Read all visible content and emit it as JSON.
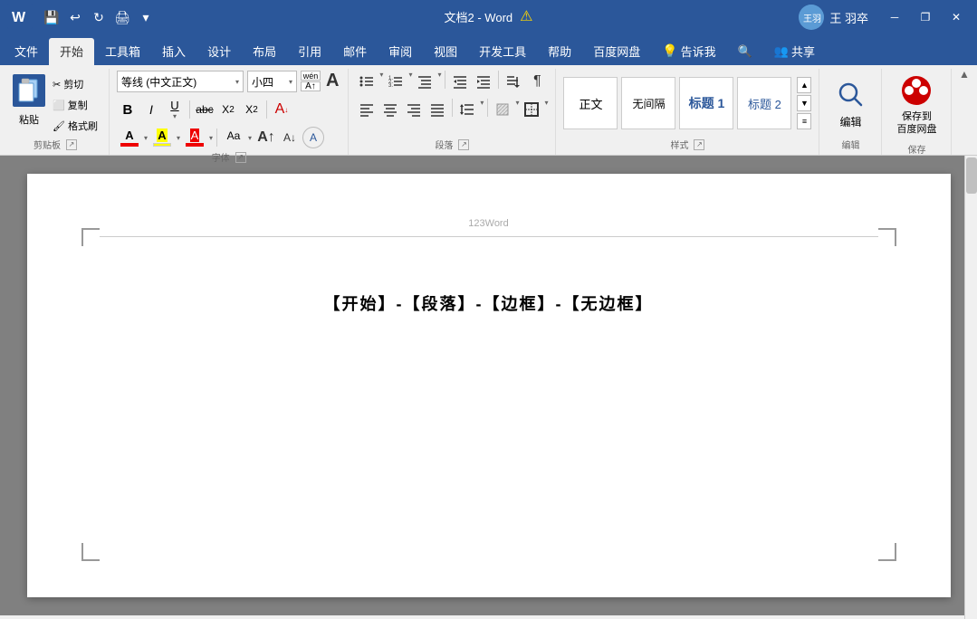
{
  "titlebar": {
    "title": "文档2 - Word",
    "warning": "⚠",
    "username": "王 羽卒",
    "quickaccess": [
      "💾",
      "↩",
      "↻",
      "🖨",
      "▼"
    ]
  },
  "windowcontrols": {
    "minimize": "─",
    "restore": "❐",
    "close": "✕"
  },
  "tabs": [
    {
      "label": "文件",
      "active": false
    },
    {
      "label": "开始",
      "active": true
    },
    {
      "label": "工具箱",
      "active": false
    },
    {
      "label": "插入",
      "active": false
    },
    {
      "label": "设计",
      "active": false
    },
    {
      "label": "布局",
      "active": false
    },
    {
      "label": "引用",
      "active": false
    },
    {
      "label": "邮件",
      "active": false
    },
    {
      "label": "审阅",
      "active": false
    },
    {
      "label": "视图",
      "active": false
    },
    {
      "label": "开发工具",
      "active": false
    },
    {
      "label": "帮助",
      "active": false
    },
    {
      "label": "百度网盘",
      "active": false
    },
    {
      "label": "❓",
      "active": false
    },
    {
      "label": "告诉我",
      "active": false
    },
    {
      "label": "🔍",
      "active": false
    },
    {
      "label": "共享",
      "active": false
    }
  ],
  "ribbon": {
    "groups": [
      {
        "name": "clipboard",
        "label": "剪贴板",
        "paste_label": "粘贴",
        "cut_label": "剪切",
        "copy_label": "复制",
        "format_label": "格式刷"
      },
      {
        "name": "font",
        "label": "字体",
        "font_name": "等线 (中文正文)",
        "font_size": "小四",
        "bold": "B",
        "italic": "I",
        "underline": "U",
        "strikethrough": "abc",
        "subscript": "X₂",
        "superscript": "X²",
        "clear_format": "A"
      },
      {
        "name": "paragraph",
        "label": "段落"
      },
      {
        "name": "styles",
        "label": "样式",
        "items": [
          "正文",
          "无间隔",
          "标题1",
          "标题2"
        ]
      },
      {
        "name": "editing",
        "label": "编辑",
        "search_label": "编辑"
      },
      {
        "name": "save",
        "label": "保存",
        "save_label": "保存到\n百度网盘"
      }
    ]
  },
  "document": {
    "header_text": "123Word",
    "cursor_char": "|",
    "main_text": "【开始】-【段落】-【边框】-【无边框】"
  },
  "colors": {
    "primary": "#2b579a",
    "accent": "#ffd700",
    "background": "#f0f0f0",
    "doc_bg": "#808080",
    "white": "#ffffff"
  }
}
